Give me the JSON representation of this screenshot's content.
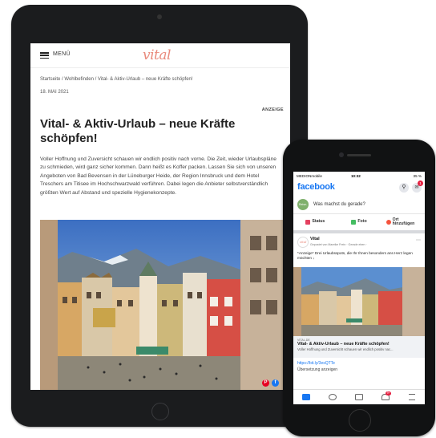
{
  "tablet": {
    "menu_label": "MENÜ",
    "logo": "vital",
    "breadcrumb": "Startseite  /  Wohlbefinden  /  Vital- & Aktiv-Urlaub – neue Kräfte schöpfen!",
    "date": "18. MAI 2021",
    "ad_label": "ANZEIGE",
    "headline": "Vital- & Aktiv-Urlaub – neue Kräfte schöpfen!",
    "body": "Voller Hoffnung und Zuversicht schauen wir endlich positiv nach vorne. Die Zeit, wieder Urlaubspläne zu schmieden, wird ganz sicher kommen. Dann heißt es Koffer packen. Lassen Sie sich von unseren Angeboten von Bad Bevensen in der Lüneburger Heide, der Region Innsbruck und dem Hotel Treschers am Titisee im Hochschwarzwald verführen. Dabei legen die Anbieter selbstverständlich größten Wert auf Abstand und spezielle Hygienekonzepte.",
    "share_pinterest": "P",
    "share_facebook": "f"
  },
  "phone": {
    "carrier": "MEDIONmobile",
    "time": "10:32",
    "battery": "35 %",
    "fb_logo": "facebook",
    "msg_badge": "1",
    "composer_avatar": "Reise-Glück",
    "composer_placeholder": "Was machst du gerade?",
    "actions": [
      {
        "label": "Status",
        "color": "#e4405f"
      },
      {
        "label": "Foto",
        "color": "#45bd62"
      },
      {
        "label": "Ort hinzufügen",
        "color": "#f5533d"
      }
    ],
    "post": {
      "avatar": "vital",
      "name": "Vital",
      "meta": "Gepostet von Mareike Frein  ·  Gerade eben  ·",
      "text": "*Anzeige* Drei Urlaubsspots, die Ihr Ihnen besonders ans Herz legen möchten ↓",
      "link_domain": "VITAL.DE",
      "link_title": "Vital- & Aktiv-Urlaub – neue Kräfte schöpfen!",
      "link_desc": "Voller Hoffnung und Zuversicht schauen wir endlich positiv nac...",
      "url": "https://bit.ly/3esQTTe",
      "translate": "Übersetzung anzeigen"
    },
    "notif_badge": "9+"
  },
  "colors": {
    "brand_pink": "#e98a7c",
    "facebook_blue": "#1877f2",
    "device_black": "#1b1c1e"
  }
}
